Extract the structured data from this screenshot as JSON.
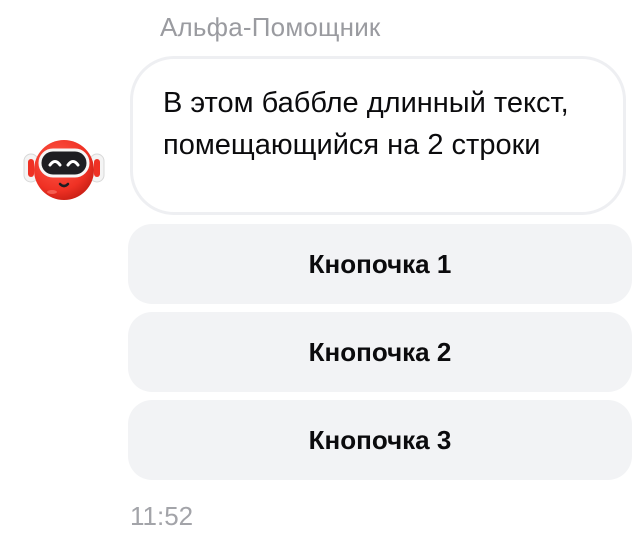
{
  "message": {
    "sender": "Альфа-Помощник",
    "text": "В этом баббле длинный текст, помещающийся на 2 строки",
    "time": "11:52",
    "avatar_icon": "robot-assistant-icon"
  },
  "quick_replies": [
    {
      "label": "Кнопочка 1"
    },
    {
      "label": "Кнопочка 2"
    },
    {
      "label": "Кнопочка 3"
    }
  ],
  "colors": {
    "avatar_red": "#ef3124",
    "button_bg": "#f2f3f5",
    "bubble_border": "#eeeff2",
    "muted_text": "#9a9ba0"
  }
}
